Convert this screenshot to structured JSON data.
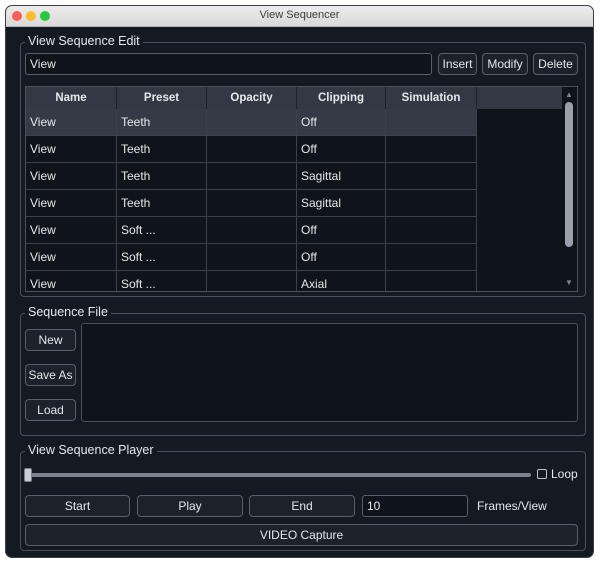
{
  "window": {
    "title": "View Sequencer"
  },
  "edit": {
    "legend": "View Sequence Edit",
    "name_value": "View",
    "insert_label": "Insert",
    "modify_label": "Modify",
    "delete_label": "Delete"
  },
  "table": {
    "columns": [
      "Name",
      "Preset",
      "Opacity",
      "Clipping",
      "Simulation"
    ],
    "rows": [
      {
        "name": "View",
        "preset": "Teeth",
        "opacity": "",
        "clipping": "Off",
        "simulation": "",
        "selected": true
      },
      {
        "name": "View",
        "preset": "Teeth",
        "opacity": "",
        "clipping": "Off",
        "simulation": ""
      },
      {
        "name": "View",
        "preset": "Teeth",
        "opacity": "",
        "clipping": "Sagittal",
        "simulation": ""
      },
      {
        "name": "View",
        "preset": "Teeth",
        "opacity": "",
        "clipping": "Sagittal",
        "simulation": ""
      },
      {
        "name": "View",
        "preset": "Soft ...",
        "opacity": "",
        "clipping": "Off",
        "simulation": ""
      },
      {
        "name": "View",
        "preset": "Soft ...",
        "opacity": "",
        "clipping": "Off",
        "simulation": ""
      },
      {
        "name": "View",
        "preset": "Soft ...",
        "opacity": "",
        "clipping": "Axial",
        "simulation": ""
      }
    ]
  },
  "file": {
    "legend": "Sequence File",
    "new_label": "New",
    "save_as_label": "Save As",
    "load_label": "Load"
  },
  "player": {
    "legend": "View Sequence Player",
    "loop_label": "Loop",
    "loop_checked": false,
    "slider_position": 0,
    "start_label": "Start",
    "play_label": "Play",
    "end_label": "End",
    "frames_value": "10",
    "frames_label": "Frames/View",
    "video_label": "VIDEO Capture"
  },
  "colors": {
    "background": "#141a22",
    "header": "#323945",
    "selected_row": "#343a46"
  }
}
